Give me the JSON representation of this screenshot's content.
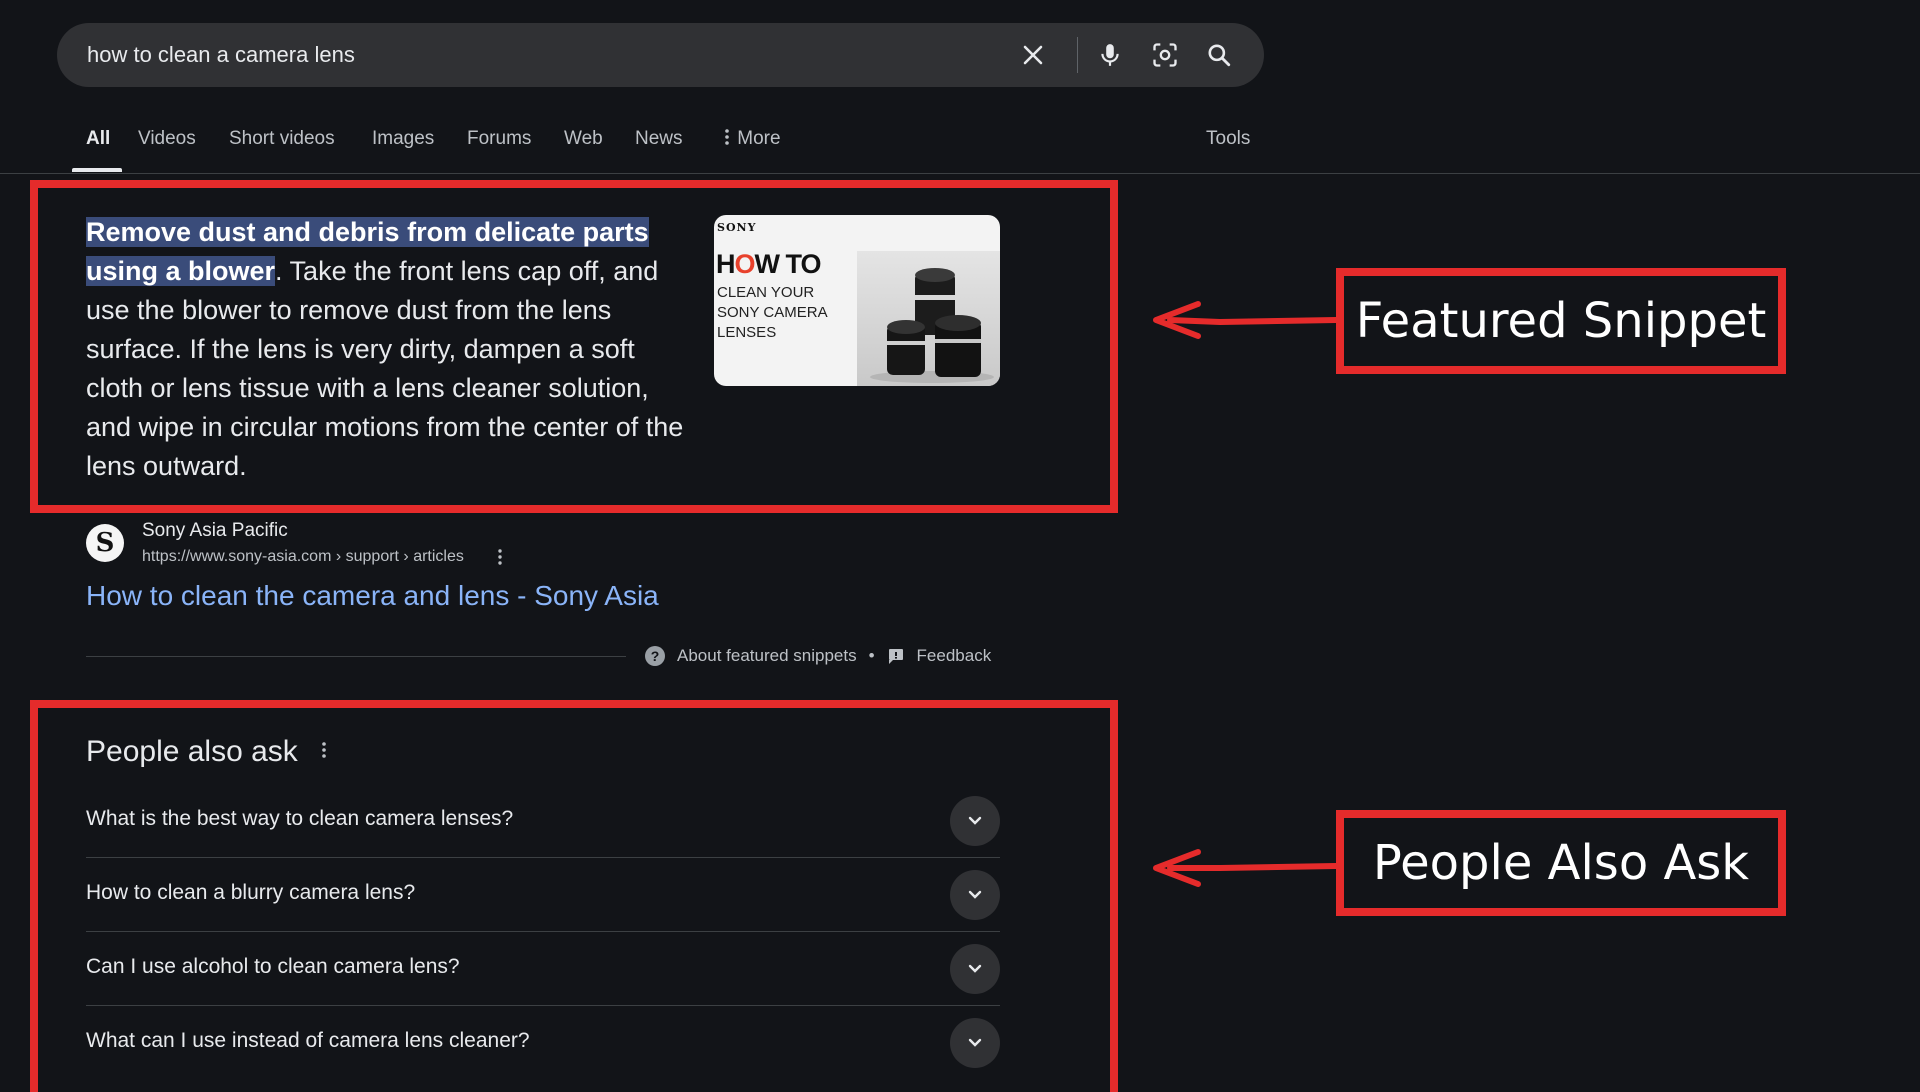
{
  "search": {
    "query": "how to clean a camera lens",
    "icons": [
      "close-icon",
      "mic-icon",
      "lens-icon",
      "search-icon"
    ]
  },
  "tabs": {
    "all": "All",
    "videos": "Videos",
    "short_videos": "Short videos",
    "images": "Images",
    "forums": "Forums",
    "web": "Web",
    "news": "News",
    "more": "More",
    "tools": "Tools"
  },
  "snippet": {
    "highlight": "Remove dust and debris from delicate parts using a blower",
    "body": ". Take the front lens cap off, and use the blower to remove dust from the lens surface. If the lens is very dirty, dampen a soft cloth or lens tissue with a lens cleaner solution, and wipe in circular motions from the center of the lens outward.",
    "thumbnail": {
      "brand": "SONY",
      "title_pre": "H",
      "title_o": "O",
      "title_post": "W TO",
      "subtitle": "CLEAN YOUR SONY CAMERA LENSES"
    },
    "source_logo": "S",
    "source_name": "Sony Asia Pacific",
    "source_url": "https://www.sony-asia.com › support › articles",
    "link_title": "How to clean the camera and lens - Sony Asia",
    "about": "About featured snippets",
    "separator": "•",
    "feedback": "Feedback"
  },
  "paa": {
    "title": "People also ask",
    "questions": [
      "What is the best way to clean camera lenses?",
      "How to clean a blurry camera lens?",
      "Can I use alcohol to clean camera lens?",
      "What can I use instead of camera lens cleaner?"
    ]
  },
  "annotations": {
    "featured_snippet": "Featured Snippet",
    "people_also_ask": "People Also Ask",
    "color": "#e52b2b"
  }
}
